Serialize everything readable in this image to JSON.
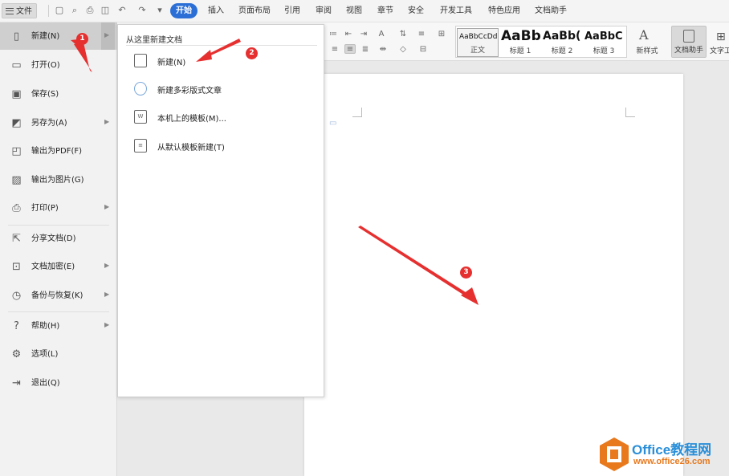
{
  "menubar": {
    "file_label": "文件",
    "tabs": [
      "开始",
      "插入",
      "页面布局",
      "引用",
      "审阅",
      "视图",
      "章节",
      "安全",
      "开发工具",
      "特色应用",
      "文档助手"
    ]
  },
  "ribbon": {
    "styles": [
      {
        "preview": "AaBbCcDd",
        "label": "正文"
      },
      {
        "preview": "AaBb",
        "label": "标题 1"
      },
      {
        "preview": "AaBb(",
        "label": "标题 2"
      },
      {
        "preview": "AaBbC",
        "label": "标题 3"
      }
    ],
    "new_style_label": "新样式",
    "doc_assistant_label": "文档助手",
    "text_tool_label": "文字工"
  },
  "file_menu": {
    "items": [
      {
        "label": "新建(N)",
        "icon": "new-doc-icon",
        "has_submenu": true
      },
      {
        "label": "打开(O)",
        "icon": "folder-icon",
        "has_submenu": false
      },
      {
        "label": "保存(S)",
        "icon": "save-icon",
        "has_submenu": false
      },
      {
        "label": "另存为(A)",
        "icon": "save-as-icon",
        "has_submenu": true
      },
      {
        "label": "输出为PDF(F)",
        "icon": "pdf-icon",
        "has_submenu": false
      },
      {
        "label": "输出为图片(G)",
        "icon": "image-icon",
        "has_submenu": false
      },
      {
        "label": "打印(P)",
        "icon": "print-icon",
        "has_submenu": true
      },
      {
        "label": "分享文档(D)",
        "icon": "share-icon",
        "has_submenu": false
      },
      {
        "label": "文档加密(E)",
        "icon": "encrypt-icon",
        "has_submenu": true
      },
      {
        "label": "备份与恢复(K)",
        "icon": "backup-icon",
        "has_submenu": true
      },
      {
        "label": "帮助(H)",
        "icon": "help-icon",
        "has_submenu": true
      },
      {
        "label": "选项(L)",
        "icon": "gear-icon",
        "has_submenu": false
      },
      {
        "label": "退出(Q)",
        "icon": "exit-icon",
        "has_submenu": false
      }
    ]
  },
  "submenu": {
    "title": "从这里新建文档",
    "items": [
      {
        "label": "新建(N)",
        "icon": "blank-doc-icon"
      },
      {
        "label": "新建多彩版式文章",
        "icon": "colorful-doc-icon"
      },
      {
        "label": "本机上的模板(M)...",
        "icon": "local-template-icon"
      },
      {
        "label": "从默认模板新建(T)",
        "icon": "default-template-icon"
      }
    ]
  },
  "annotations": [
    "1",
    "2",
    "3"
  ],
  "watermark": {
    "brand": "Office教程网",
    "url": "www.office26.com"
  },
  "colors": {
    "accent": "#2b6fd6",
    "annotation": "#e63030",
    "brand_blue": "#2a8fd8",
    "brand_orange": "#e8791d"
  }
}
